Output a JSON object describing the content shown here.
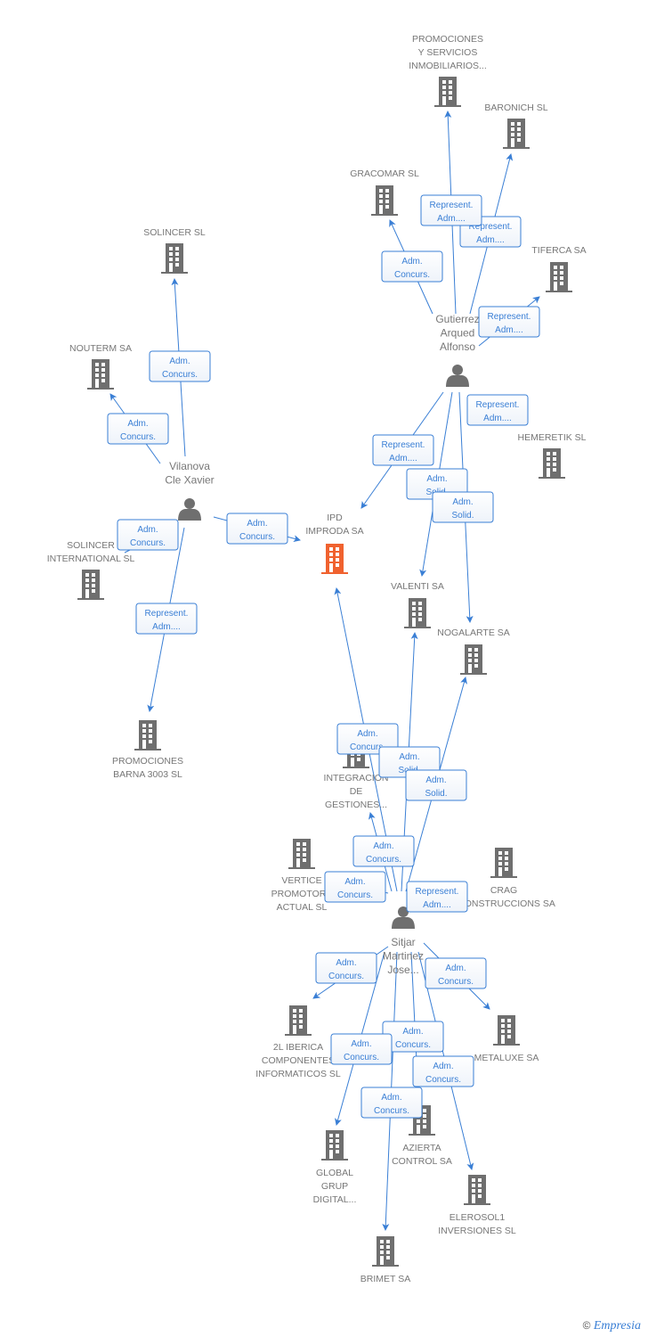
{
  "colors": {
    "edge": "#3a7fd5",
    "node": "#6f6f6f",
    "focus": "#f0622f",
    "label_text": "#777777"
  },
  "nodes": [
    {
      "id": "promo_serv",
      "type": "company",
      "label": [
        "PROMOCIONES",
        "Y SERVICIOS",
        "INMOBILIARIOS..."
      ]
    },
    {
      "id": "baronich",
      "type": "company",
      "label": [
        "BARONICH SL"
      ]
    },
    {
      "id": "gracomar",
      "type": "company",
      "label": [
        "GRACOMAR SL"
      ]
    },
    {
      "id": "tiferca",
      "type": "company",
      "label": [
        "TIFERCA SA"
      ]
    },
    {
      "id": "gutierrez",
      "type": "person",
      "label": [
        "Gutierrez",
        "Arqued",
        "Alfonso"
      ]
    },
    {
      "id": "hemeretik",
      "type": "company",
      "label": [
        "HEMERETIK SL"
      ]
    },
    {
      "id": "solincer",
      "type": "company",
      "label": [
        "SOLINCER SL"
      ]
    },
    {
      "id": "nouterm",
      "type": "company",
      "label": [
        "NOUTERM SA"
      ]
    },
    {
      "id": "vilanova",
      "type": "person",
      "label": [
        "Vilanova",
        "Cle Xavier"
      ]
    },
    {
      "id": "solincer_intl",
      "type": "company",
      "label": [
        "SOLINCER",
        "INTERNATIONAL SL"
      ]
    },
    {
      "id": "ipd",
      "type": "company",
      "focus": true,
      "label": [
        "IPD",
        "IMPRODA SA"
      ]
    },
    {
      "id": "valenti",
      "type": "company",
      "label": [
        "VALENTI SA"
      ]
    },
    {
      "id": "nogalarte",
      "type": "company",
      "label": [
        "NOGALARTE SA"
      ]
    },
    {
      "id": "promo_barna",
      "type": "company",
      "label": [
        "PROMOCIONES",
        "BARNA 3003 SL"
      ]
    },
    {
      "id": "integracion",
      "type": "company",
      "label": [
        "INTEGRACION",
        "DE",
        "GESTIONES..."
      ]
    },
    {
      "id": "vertice",
      "type": "company",
      "label": [
        "VERTICE",
        "PROMOTORA",
        "ACTUAL SL"
      ]
    },
    {
      "id": "crag",
      "type": "company",
      "label": [
        "CRAG",
        "CONSTRUCCIONS SA"
      ]
    },
    {
      "id": "sitjar",
      "type": "person",
      "label": [
        "Sitjar",
        "Martinez",
        "Jose..."
      ]
    },
    {
      "id": "iberica",
      "type": "company",
      "label": [
        "2L IBERICA",
        "COMPONENTES",
        "INFORMATICOS SL"
      ]
    },
    {
      "id": "metaluxe",
      "type": "company",
      "label": [
        "METALUXE SA"
      ]
    },
    {
      "id": "azierta",
      "type": "company",
      "label": [
        "AZIERTA",
        "CONTROL SA"
      ]
    },
    {
      "id": "global",
      "type": "company",
      "label": [
        "GLOBAL",
        "GRUP",
        "DIGITAL..."
      ]
    },
    {
      "id": "elerosol",
      "type": "company",
      "label": [
        "ELEROSOL1",
        "INVERSIONES SL"
      ]
    },
    {
      "id": "brimet",
      "type": "company",
      "label": [
        "BRIMET SA"
      ]
    }
  ],
  "edges": [
    {
      "from": "gutierrez",
      "to": "gracomar",
      "label": [
        "Adm.",
        "Concurs."
      ]
    },
    {
      "from": "gutierrez",
      "to": "baronich",
      "label": [
        "Represent.",
        "Adm...."
      ]
    },
    {
      "from": "gutierrez",
      "to": "promo_serv",
      "label": [
        "Represent.",
        "Adm...."
      ]
    },
    {
      "from": "gutierrez",
      "to": "tiferca",
      "label": [
        "Represent.",
        "Adm...."
      ]
    },
    {
      "from": "gutierrez",
      "to": "hemeretik",
      "label": [
        "Represent.",
        "Adm...."
      ]
    },
    {
      "from": "gutierrez",
      "to": "ipd",
      "label": [
        "Represent.",
        "Adm...."
      ]
    },
    {
      "from": "gutierrez",
      "to": "valenti",
      "label": [
        "Adm.",
        "Solid."
      ]
    },
    {
      "from": "gutierrez",
      "to": "nogalarte",
      "label": [
        "Adm.",
        "Solid."
      ]
    },
    {
      "from": "vilanova",
      "to": "solincer",
      "label": [
        "Adm.",
        "Concurs."
      ]
    },
    {
      "from": "vilanova",
      "to": "nouterm",
      "label": [
        "Adm.",
        "Concurs."
      ]
    },
    {
      "from": "vilanova",
      "to": "solincer_intl",
      "label": [
        "Adm.",
        "Concurs."
      ]
    },
    {
      "from": "vilanova",
      "to": "ipd",
      "label": [
        "Adm.",
        "Concurs."
      ]
    },
    {
      "from": "vilanova",
      "to": "promo_barna",
      "label": [
        "Represent.",
        "Adm...."
      ]
    },
    {
      "from": "sitjar",
      "to": "ipd",
      "label": [
        "Adm.",
        "Concurs."
      ]
    },
    {
      "from": "sitjar",
      "to": "valenti",
      "label": [
        "Adm.",
        "Solid."
      ]
    },
    {
      "from": "sitjar",
      "to": "nogalarte",
      "label": [
        "Adm.",
        "Solid."
      ]
    },
    {
      "from": "sitjar",
      "to": "integracion",
      "label": [
        "Adm.",
        "Concurs."
      ]
    },
    {
      "from": "sitjar",
      "to": "vertice",
      "label": [
        "Adm.",
        "Concurs."
      ]
    },
    {
      "from": "sitjar",
      "to": "crag",
      "label": [
        "Represent.",
        "Adm...."
      ]
    },
    {
      "from": "sitjar",
      "to": "iberica",
      "label": [
        "Adm.",
        "Concurs."
      ]
    },
    {
      "from": "sitjar",
      "to": "metaluxe",
      "label": [
        "Adm.",
        "Concurs."
      ]
    },
    {
      "from": "sitjar",
      "to": "azierta",
      "label": [
        "Adm.",
        "Concurs."
      ]
    },
    {
      "from": "sitjar",
      "to": "global",
      "label": [
        "Adm.",
        "Concurs."
      ]
    },
    {
      "from": "sitjar",
      "to": "elerosol",
      "label": [
        "Adm.",
        "Concurs."
      ]
    },
    {
      "from": "sitjar",
      "to": "brimet",
      "label": [
        "Adm.",
        "Concurs."
      ]
    }
  ],
  "footer": {
    "copyright": "©",
    "brand": "Empresia"
  }
}
